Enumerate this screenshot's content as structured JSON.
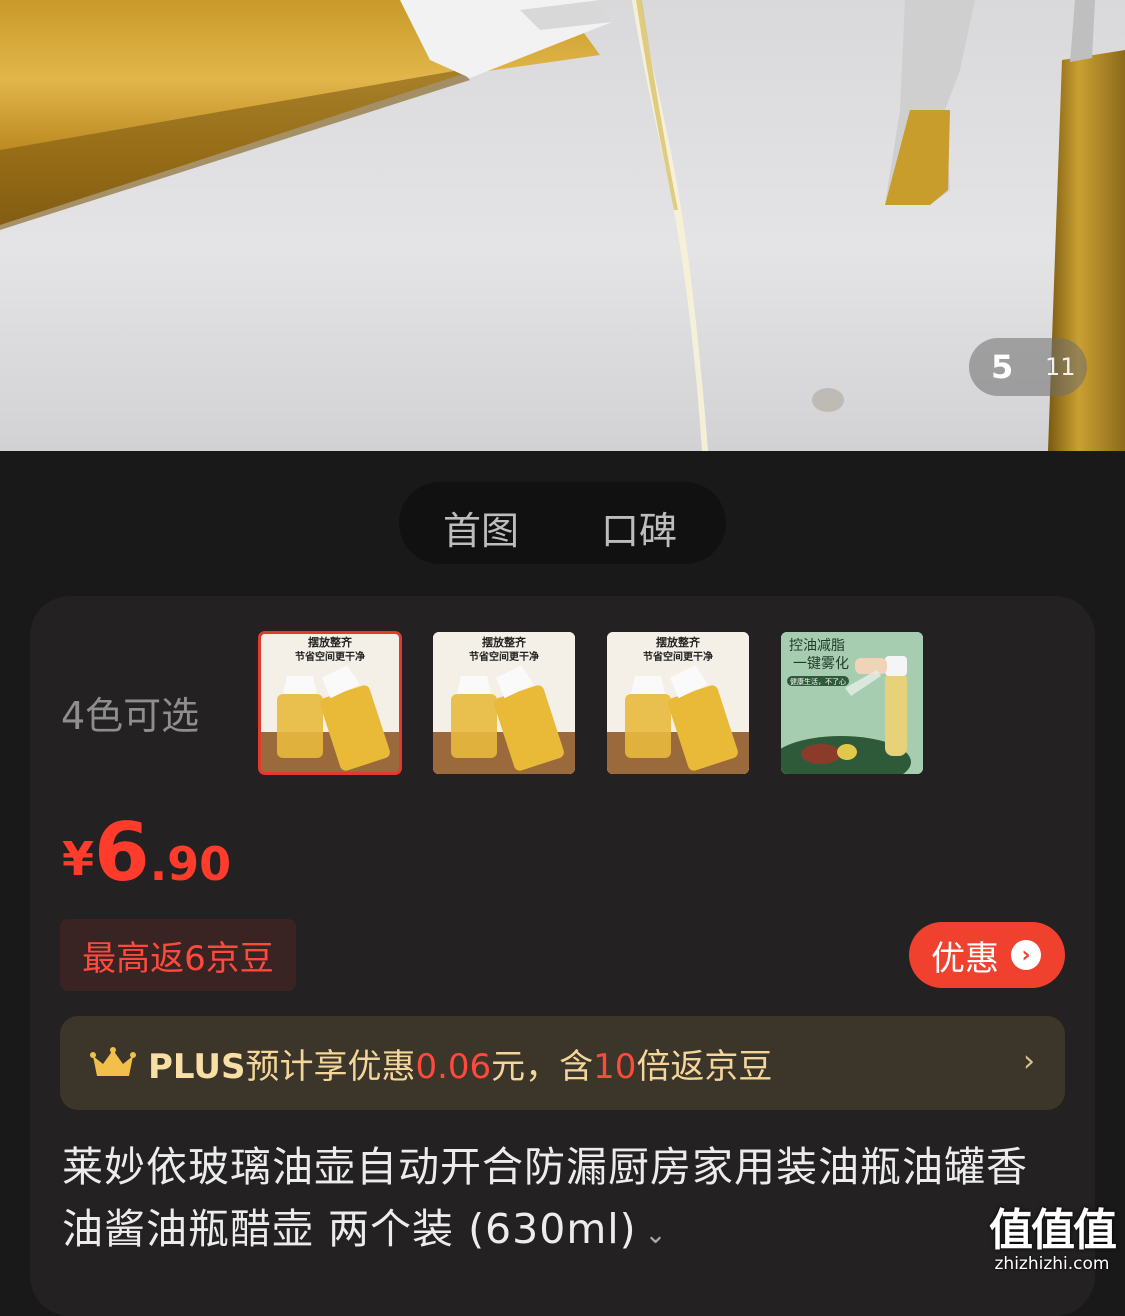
{
  "gallery": {
    "current_page": "5",
    "total_pages": "11"
  },
  "tabs": [
    {
      "label": "首图"
    },
    {
      "label": "口碑"
    }
  ],
  "variants": {
    "label": "4色可选",
    "thumbnails": [
      {
        "caption_line1": "摆放整齐",
        "caption_line2": "节省空间更干净",
        "selected": true
      },
      {
        "caption_line1": "摆放整齐",
        "caption_line2": "节省空间更干净",
        "selected": false
      },
      {
        "caption_line1": "摆放整齐",
        "caption_line2": "节省空间更干净",
        "selected": false
      },
      {
        "caption_line1": "控油减脂",
        "caption_line2": "一键雾化",
        "caption_line3": "健康生活，不了心",
        "selected": false
      }
    ]
  },
  "price": {
    "currency": "¥",
    "integer": "6",
    "decimal": ".90",
    "color": "#ff3c2c"
  },
  "rebate_tag": "最高返6京豆",
  "promo_button": {
    "label": "优惠",
    "arrow": "›"
  },
  "plus_bar": {
    "plus": "PLUS",
    "text_a": "预计享优惠",
    "amount": "0.06",
    "text_b": "元，含",
    "multiplier": "10",
    "text_c": "倍返京豆",
    "chevron": "›",
    "icon": "crown-icon"
  },
  "product_title": "莱妙依玻璃油壶自动开合防漏厨房家用装油瓶油罐香油酱油瓶醋壶 两个装 (630ml)",
  "title_more": "⌄",
  "watermark": {
    "logo": "值值值",
    "url": "zhizhizhi.com"
  }
}
